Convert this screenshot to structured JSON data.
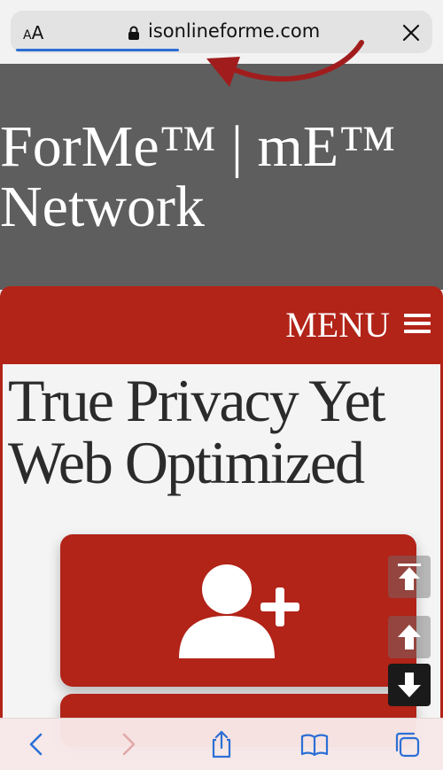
{
  "browser": {
    "text_size_label_small": "A",
    "text_size_label_large": "A",
    "url": "isonlineforme.com",
    "lock_icon": "lock-icon",
    "close_icon": "close-icon",
    "accent_color": "#2c6fd6"
  },
  "site": {
    "title": "ForMe™ | mE™ Network",
    "menu_label": "MENU",
    "brand_red": "#b22318"
  },
  "main": {
    "headline": "True Privacy Yet Web Optimized",
    "card_icon": "add-user-icon"
  },
  "scroll_controls": [
    "scroll-to-top-icon",
    "scroll-up-icon",
    "scroll-down-icon"
  ],
  "toolbar": {
    "icons": [
      "back-icon",
      "forward-icon",
      "share-icon",
      "bookmarks-icon",
      "tabs-icon"
    ]
  }
}
